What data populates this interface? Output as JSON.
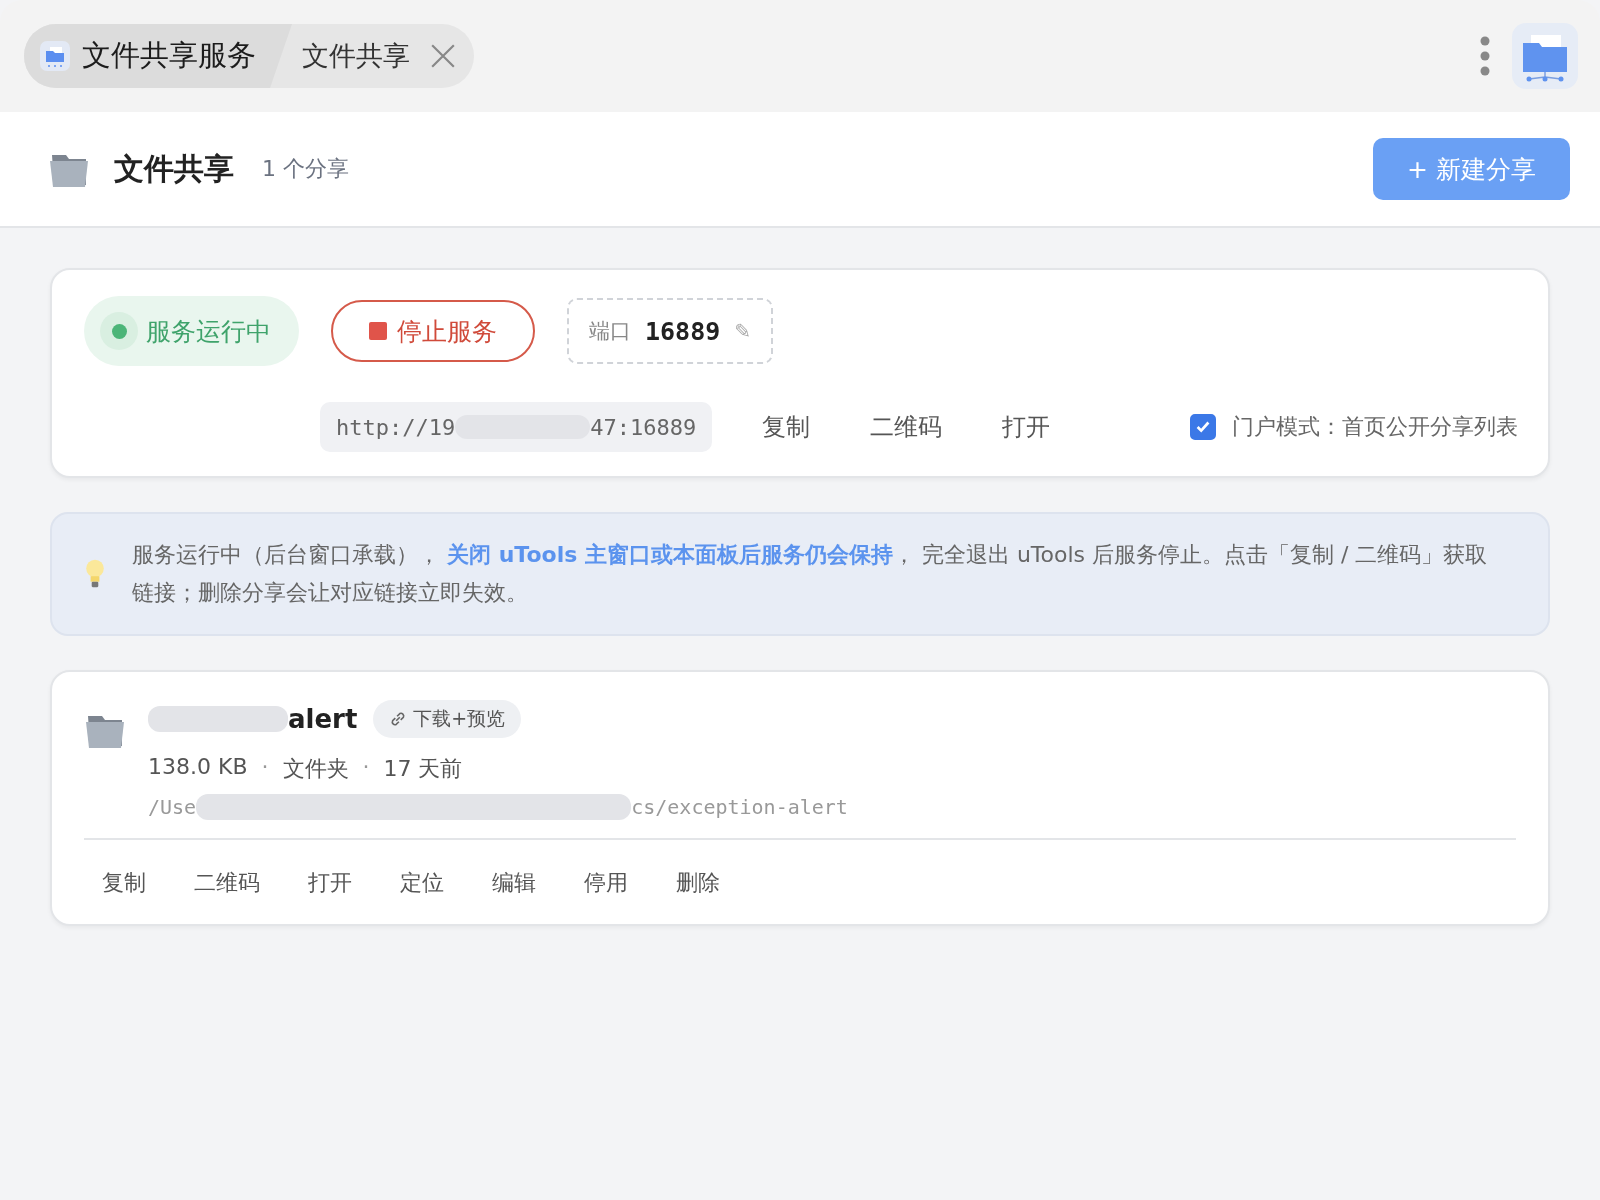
{
  "title_bar": {
    "breadcrumbs": [
      {
        "kind": "app",
        "label": "文件共享服务"
      },
      {
        "kind": "page",
        "label": "文件共享"
      }
    ]
  },
  "header": {
    "title": "文件共享",
    "count": "1 个分享",
    "new_button": "+ 新建分享"
  },
  "service": {
    "status": "服务运行中",
    "running": true,
    "stop_button": "停止服务",
    "port_label": "端口",
    "port": "16889",
    "edit_glyph": "✎",
    "url_start": "http://19",
    "url_end": "47:16889",
    "actions": [
      "复制",
      "二维码",
      "打开"
    ],
    "portal": {
      "label": "门户模式：首页公开分享列表",
      "checked": true
    }
  },
  "notice": {
    "text": "服务运行中（后台窗口承载）， **关闭 uTools 主窗口或本面板后服务仍会保持**， 完全退出 uTools 后服务停止。点击「复制 / 二维码」获取链接；删除分享会让对应链接立即失效。"
  },
  "shares": [
    {
      "name_end": "alert",
      "tag": "下载+预览",
      "size": "138.0 KB",
      "type": "文件夹",
      "age": "17 天前",
      "separator": "·",
      "path_start": "/Use",
      "path_end": "cs/exception-alert",
      "actions": [
        "复制",
        "二维码",
        "打开",
        "定位",
        "编辑",
        "停用",
        "删除"
      ]
    }
  ]
}
